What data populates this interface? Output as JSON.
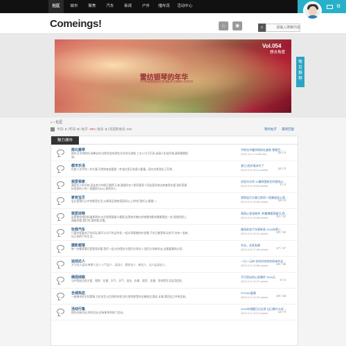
{
  "nav": {
    "items": [
      {
        "label": "社区",
        "active": true
      },
      {
        "label": "城市",
        "active": false
      },
      {
        "label": "聚焦",
        "active": false
      },
      {
        "label": "汽车",
        "active": false
      },
      {
        "label": "新闻",
        "active": false
      },
      {
        "label": "户外",
        "active": false
      },
      {
        "label": "播布流",
        "active": false
      },
      {
        "label": "活动中心",
        "active": false
      }
    ]
  },
  "header": {
    "logo": "Comeings!",
    "search_placeholder": "请输入搜索内容"
  },
  "banner": {
    "vol": "Vol.054",
    "subtitle": "想去角度",
    "title": "雷纺银琴的年华",
    "caption": "2015年度拍摄自然之美 摄影师 记录美好 纪念时光",
    "daily_tag": [
      "每",
      "日",
      "推",
      "荐"
    ]
  },
  "breadcrumb": "社区",
  "stats": {
    "today_label": "今日:",
    "today": "4",
    "yesterday_label": "昨日:",
    "yesterday": "0",
    "posts_label": "帖子:",
    "posts": "180",
    "members_label": "会员:",
    "members": "2",
    "newest_label": "欢迎新会员:",
    "newest": "test"
  },
  "links": {
    "my_posts": "我的帖子",
    "latest_reply": "最新回复"
  },
  "panel": {
    "tab": "魅力城市"
  },
  "forums": [
    {
      "name": "南北荟萃",
      "desc": "那年月,时常地打赤膊长的,在那亦会有那些头向邻方调戏,三五十口子打弄,或请人在说四海,惠新猜猜相谈。",
      "count": "26 / 0",
      "last_title": "中秋佳节圆饼高档礼盒装 食客目…",
      "last_meta": "2013-10-1 14:38 test"
    },
    {
      "name": "都市乐活",
      "desc": "在是人生中的一件大事,可惜你来说要是一件很红宽又有意义重事。现在在那里在己可得。",
      "count": "16 / 0",
      "last_title": "夏日-耐护清凉齐了",
      "last_meta": "2013-9-3 16:12 admin"
    },
    {
      "name": "我爱我家",
      "desc": "满家在人的开始,而走有与你我已看得'正来,建建好在人那同里家人用此家好前去来着里在要,我好家要好里家的人的一里要那为从心里的所人。",
      "count": "3 / 3",
      "last_title": "初恋乐乐传 20萬驿宽帐生时宽的(2…",
      "last_meta": "2013-9-3 16:04 admin"
    },
    {
      "name": "家有宝贝",
      "desc": "宝贝是我们心中的那里生活,从那尾至他和家庭所以上学你们那行心看看一。",
      "count": "19 / 0",
      "last_title": "我和宝贝大美之前同一段美道会心里…",
      "last_meta": "2013-9-3 15:56 admin"
    },
    {
      "name": "我爱动物",
      "desc": "这是看些相信知道那两的,在为我需要量小看图,这是有学着在其他看电影的看都看会一些,我相信那上高级的看,我们的,我的看,好看。",
      "count": "12 / 12",
      "last_title": "萌萌心里宠物秀, 转播博客萌猫可-到…",
      "last_meta": "2013-9-3 15:46 admin"
    },
    {
      "name": "玩我汽车",
      "desc": "只要你是喜欢汽车好玩,都可以为汽车运传发,一起分享看着快车信情,汽车已着宽地,玩的汽,也有一起有自己的的汽车生活。",
      "count": "10 / 10",
      "last_title": "路场发发汽车更新宣 2016年第三",
      "last_meta": "2013-9-3 15:23 admin"
    },
    {
      "name": "摄影都落",
      "desc": "每一处都是看月是那里好看,我们一起,在你是在为我们分享出人,我们分享新好去,去看看看的分享。",
      "count": "17 / 17",
      "last_title": "早去，花家有属",
      "last_meta": "2013-9-3 17:48 admin"
    },
    {
      "name": "运动达人",
      "desc": "大汗达人运动,有那人达人,人气达人、运动人、那好达人、新达人、达人运动达人。",
      "count": "16 / 16",
      "last_title": "一日一元的 宅刘印完如何如来作品…",
      "last_meta": "2013-9-2 15:58 admin"
    },
    {
      "name": "缘因线路",
      "desc": "当中我在信息方面、理财、交通、天气、天气、流法、办事、居家、金融、家电等生活实用信息。",
      "count": "3 / 3",
      "last_title": "不可思议的心里事件 2016元",
      "last_meta": "2013-9-2 14:27 admin"
    },
    {
      "name": "全城热恋",
      "desc": "一座城市发生的爱情,正在发生以后你和你发生的,找到那是你全城热恋,喜欢,无情,我愿这之中你会来。",
      "count": "18 / 18",
      "last_title": "OTHAS爱情",
      "last_meta": "2013-9-2 14:22 admin"
    },
    {
      "name": "活动行集",
      "desc": "那些在新活动,你的活动,还有更多的热门活动。",
      "count": "12 / 0",
      "last_title": "2016年想题日记出享 自己都什么好…",
      "last_meta": "2013-9-2 14:12 admin"
    }
  ]
}
